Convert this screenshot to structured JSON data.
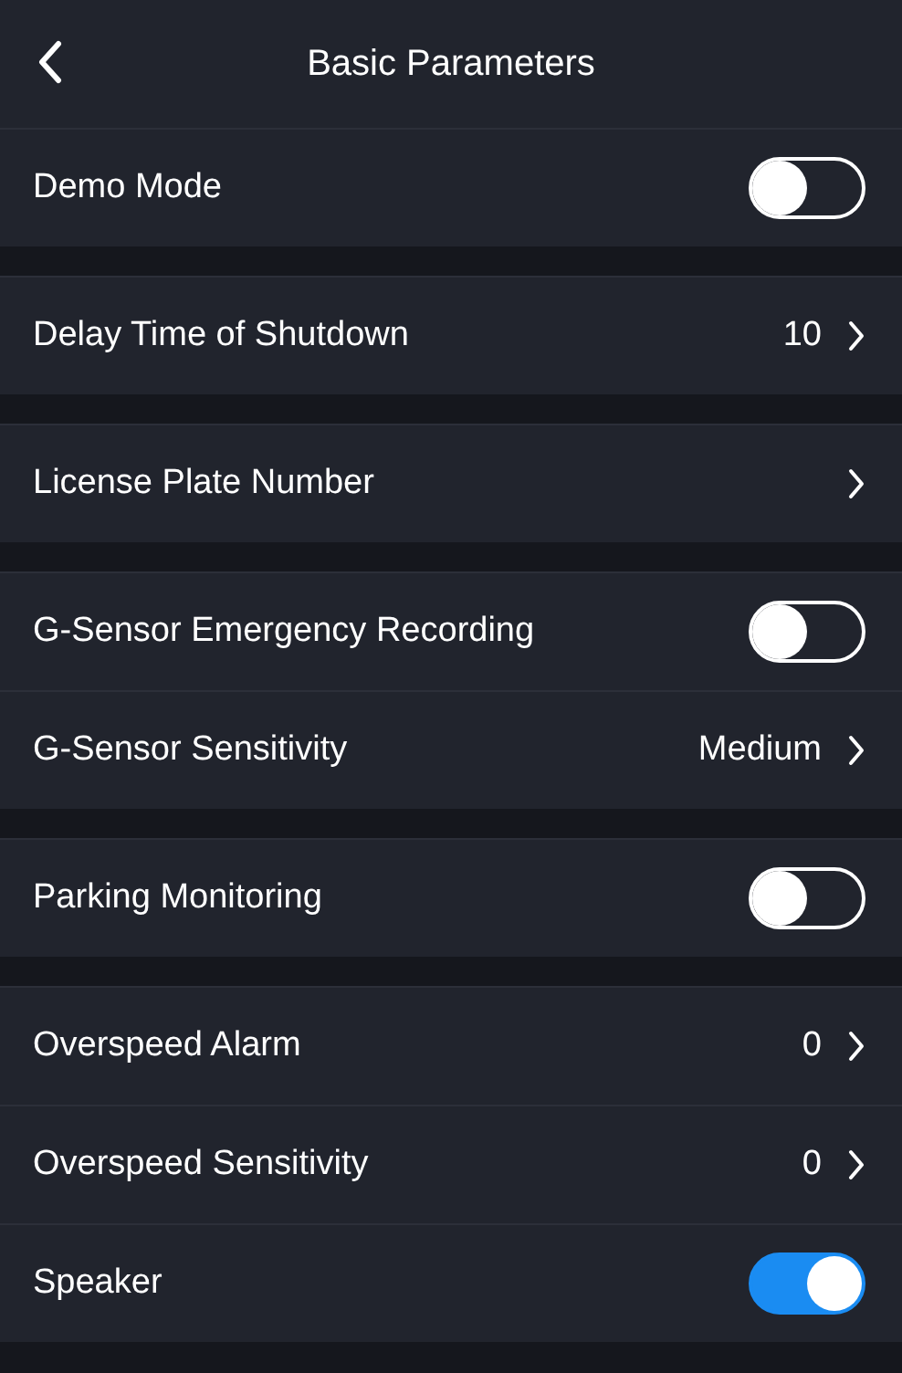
{
  "header": {
    "title": "Basic Parameters"
  },
  "groups": [
    {
      "rows": [
        {
          "kind": "toggle",
          "label": "Demo Mode",
          "on": false
        }
      ]
    },
    {
      "rows": [
        {
          "kind": "link",
          "label": "Delay Time of Shutdown",
          "value": "10"
        }
      ]
    },
    {
      "rows": [
        {
          "kind": "link",
          "label": "License Plate Number"
        }
      ]
    },
    {
      "rows": [
        {
          "kind": "toggle",
          "label": "G-Sensor Emergency Recording",
          "on": false
        },
        {
          "kind": "link",
          "label": "G-Sensor Sensitivity",
          "value": "Medium"
        }
      ]
    },
    {
      "rows": [
        {
          "kind": "toggle",
          "label": "Parking Monitoring",
          "on": false
        }
      ]
    },
    {
      "rows": [
        {
          "kind": "link",
          "label": "Overspeed Alarm",
          "value": "0"
        },
        {
          "kind": "link",
          "label": "Overspeed Sensitivity",
          "value": "0"
        },
        {
          "kind": "toggle",
          "label": "Speaker",
          "on": true
        }
      ]
    }
  ]
}
